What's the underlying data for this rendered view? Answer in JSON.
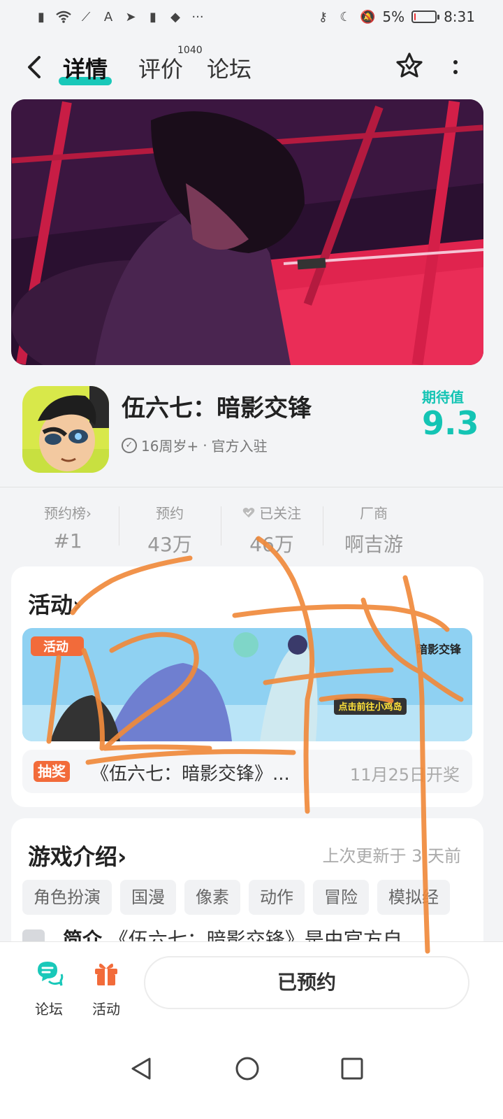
{
  "status_bar": {
    "battery": "5%",
    "time": "8:31",
    "battery_level": 0.05
  },
  "nav": {
    "tabs": {
      "detail": "详情",
      "review": "评价",
      "review_count": "1040",
      "forum": "论坛"
    }
  },
  "app": {
    "title": "伍六七：暗影交锋",
    "age": "16周岁+",
    "official": "官方入驻",
    "separator": "·",
    "expect_label": "期待值",
    "expect_value": "9.3"
  },
  "stats": [
    {
      "label": "预约榜",
      "value": "#1",
      "chevron": "›"
    },
    {
      "label": "预约",
      "value": "43万"
    },
    {
      "label": "已关注",
      "value": "46万",
      "icon": "heart-icon"
    },
    {
      "label": "厂商",
      "value": "啊吉游"
    }
  ],
  "activity": {
    "title": "活动",
    "chevron": "›",
    "banner_badge": "活动",
    "banner_cta": "点击前往小鸡岛",
    "banner_logo": "暗影交锋",
    "lottery_badge": "抽奖",
    "lottery_text": "《伍六七：暗影交锋》...",
    "lottery_date": "11月25日开奖"
  },
  "intro": {
    "title": "游戏介绍",
    "chevron": "›",
    "updated": "上次更新于 3 天前",
    "tags": [
      "角色扮演",
      "国漫",
      "像素",
      "动作",
      "冒险",
      "模拟经"
    ],
    "brief_label": "简介",
    "brief_text": "《伍六七：暗影交锋》是由官方自"
  },
  "bottom": {
    "forum": "论坛",
    "activity": "活动",
    "reserve_button": "已预约"
  },
  "colors": {
    "accent": "#19c8b9",
    "orange": "#f26b3a",
    "scribble": "#f08a3c"
  }
}
